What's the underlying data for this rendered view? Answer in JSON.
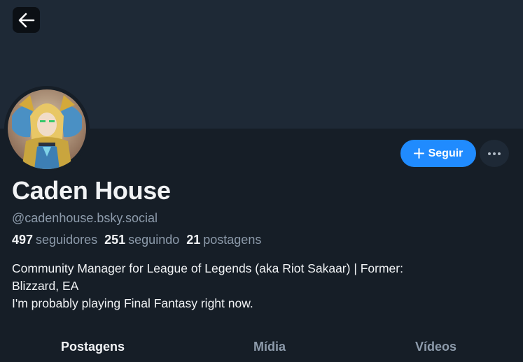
{
  "header": {
    "back_icon": "arrow-left-icon"
  },
  "profile": {
    "display_name": "Caden House",
    "handle": "@cadenhouse.bsky.social",
    "follow_label": "Seguir",
    "more_icon": "ellipsis-icon",
    "stats": {
      "followers_count": "497",
      "followers_label": "seguidores",
      "following_count": "251",
      "following_label": "seguindo",
      "posts_count": "21",
      "posts_label": "postagens"
    },
    "bio_lines": [
      "Community Manager for League of Legends (aka Riot Sakaar) | Former:",
      "Blizzard, EA",
      "I'm probably playing Final Fantasy right now."
    ]
  },
  "tabs": [
    {
      "label": "Postagens",
      "active": true
    },
    {
      "label": "Mídia",
      "active": false
    },
    {
      "label": "Vídeos",
      "active": false
    }
  ],
  "colors": {
    "background": "#161e27",
    "banner": "#1e2936",
    "accent": "#208bfe",
    "muted_text": "#8d9bab"
  }
}
